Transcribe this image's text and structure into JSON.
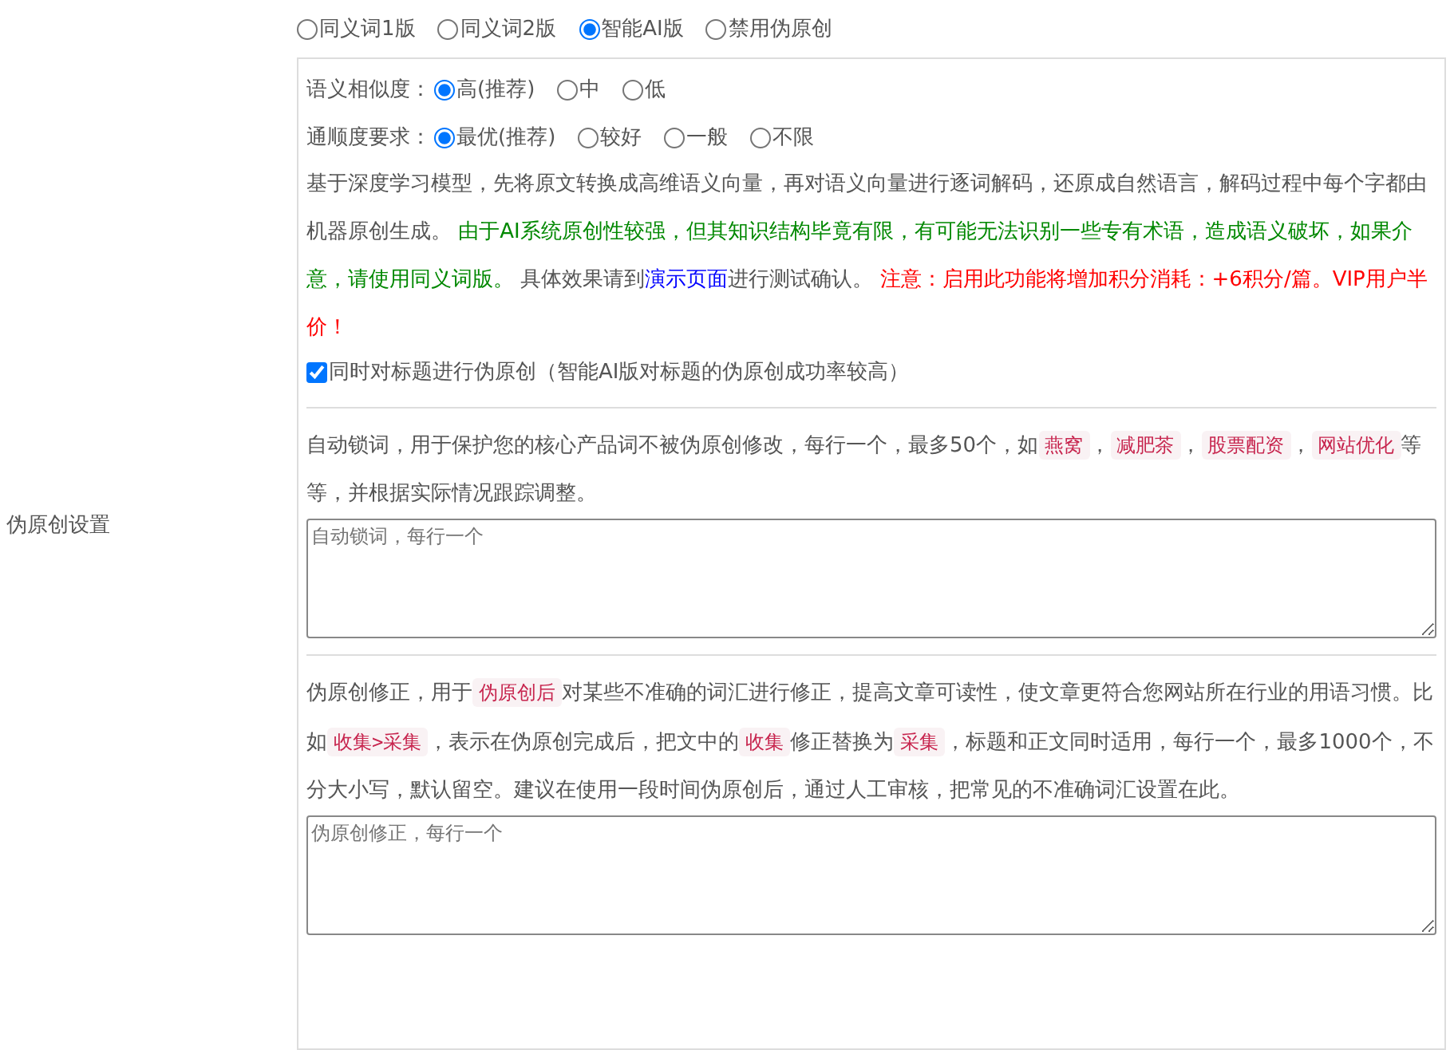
{
  "row_label": "伪原创设置",
  "modes": [
    {
      "label": "同义词1版",
      "selected": false
    },
    {
      "label": "同义词2版",
      "selected": false
    },
    {
      "label": "智能AI版",
      "selected": true
    },
    {
      "label": "禁用伪原创",
      "selected": false
    }
  ],
  "similarity": {
    "label": "语义相似度：",
    "options": [
      {
        "label": "高(推荐)",
        "selected": true
      },
      {
        "label": "中",
        "selected": false
      },
      {
        "label": "低",
        "selected": false
      }
    ]
  },
  "fluency": {
    "label": "通顺度要求：",
    "options": [
      {
        "label": "最优(推荐)",
        "selected": true
      },
      {
        "label": "较好",
        "selected": false
      },
      {
        "label": "一般",
        "selected": false
      },
      {
        "label": "不限",
        "selected": false
      }
    ]
  },
  "description": [
    {
      "kind": "plain",
      "text": "基于深度学习模型，先将原文转换成高维语义向量，再对语义向量进行逐词解码，还原成自然语言，解码过程中每个字都由机器原创生成。 "
    },
    {
      "kind": "note",
      "text": "由于AI系统原创性较强，但其知识结构毕竟有限，有可能无法识别一些专有术语，造成语义破坏，如果介意，请使用同义词版。"
    },
    {
      "kind": "plain",
      "text": " 具体效果请到"
    },
    {
      "kind": "link",
      "text": "演示页面"
    },
    {
      "kind": "plain",
      "text": "进行测试确认。 "
    },
    {
      "kind": "warning",
      "text": "注意：启用此功能将增加积分消耗：+6积分/篇。VIP用户半价！"
    }
  ],
  "title_option": {
    "label": "同时对标题进行伪原创（智能AI版对标题的伪原创成功率较高）",
    "checked": true
  },
  "lock_words": {
    "help": [
      {
        "kind": "plain",
        "text": "自动锁词，用于保护您的核心产品词不被伪原创修改，每行一个，最多50个，如"
      },
      {
        "kind": "code",
        "text": "燕窝"
      },
      {
        "kind": "plain",
        "text": "，"
      },
      {
        "kind": "code",
        "text": "减肥茶"
      },
      {
        "kind": "plain",
        "text": "，"
      },
      {
        "kind": "code",
        "text": "股票配资"
      },
      {
        "kind": "plain",
        "text": "，"
      },
      {
        "kind": "code",
        "text": "网站优化"
      },
      {
        "kind": "plain",
        "text": "等等，并根据实际情况跟踪调整。"
      }
    ],
    "placeholder": "自动锁词，每行一个"
  },
  "corrections": {
    "help": [
      {
        "kind": "plain",
        "text": "伪原创修正，用于"
      },
      {
        "kind": "code",
        "text": "伪原创后"
      },
      {
        "kind": "plain",
        "text": "对某些不准确的词汇进行修正，提高文章可读性，使文章更符合您网站所在行业的用语习惯。比如"
      },
      {
        "kind": "code",
        "text": "收集>采集"
      },
      {
        "kind": "plain",
        "text": "，表示在伪原创完成后，把文中的"
      },
      {
        "kind": "code",
        "text": "收集"
      },
      {
        "kind": "plain",
        "text": "修正替换为"
      },
      {
        "kind": "code",
        "text": "采集"
      },
      {
        "kind": "plain",
        "text": "，标题和正文同时适用，每行一个，最多1000个，不分大小写，默认留空。建议在使用一段时间伪原创后，通过人工审核，把常见的不准确词汇设置在此。"
      }
    ],
    "placeholder": "伪原创修正，每行一个"
  }
}
